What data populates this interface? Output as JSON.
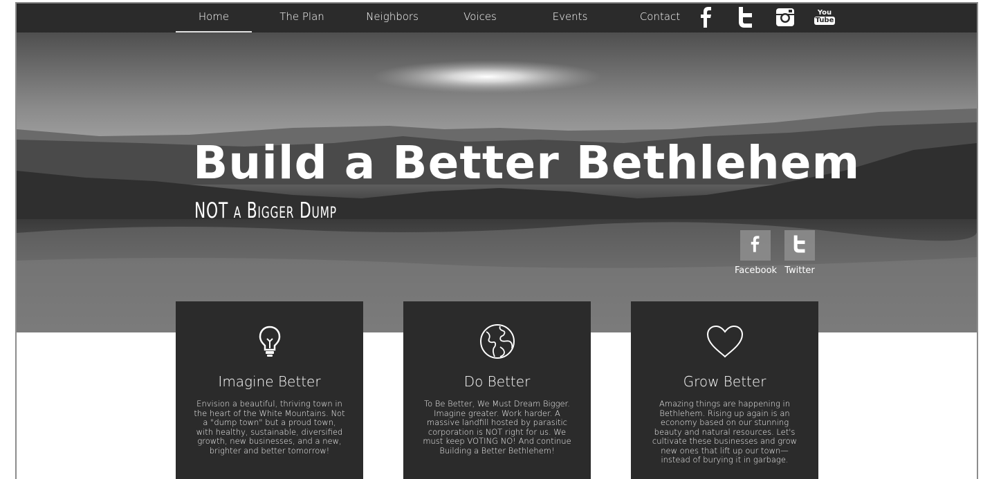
{
  "nav": {
    "items": [
      {
        "label": "Home",
        "active": true
      },
      {
        "label": "The Plan",
        "active": false
      },
      {
        "label": "Neighbors",
        "active": false
      },
      {
        "label": "Voices",
        "active": false
      },
      {
        "label": "Events",
        "active": false
      },
      {
        "label": "Contact",
        "active": false
      }
    ],
    "social": [
      {
        "icon": "facebook-icon"
      },
      {
        "icon": "twitter-icon"
      },
      {
        "icon": "instagram-icon"
      },
      {
        "icon": "youtube-icon",
        "text_top": "You",
        "text_bottom": "Tube"
      }
    ]
  },
  "hero": {
    "title": "Build a Better Bethlehem",
    "subtitle": "NOT a Bigger Dump",
    "share": [
      {
        "label": "Facebook",
        "icon": "facebook-icon"
      },
      {
        "label": "Twitter",
        "icon": "twitter-icon"
      }
    ]
  },
  "cards": [
    {
      "icon": "lightbulb-icon",
      "title": "Imagine Better",
      "text": "Envision a beautiful, thriving  town in the heart of the White Mountains. Not a \"dump town\" but a proud town, with healthy, sustainable, diversified growth, new businesses, and a new, brighter and better tomorrow!"
    },
    {
      "icon": "globe-icon",
      "title": "Do Better",
      "text": "To Be Better, We Must Dream Bigger. Imagine greater. Work harder. A massive landfill hosted by parasitic corporation is NOT right for us. We must keep VOTING NO!  And continue Building a Better Bethlehem!"
    },
    {
      "icon": "heart-icon",
      "title": "Grow Better",
      "text": "Amazing things are happening in Bethlehem. Rising up again is an economy based on our stunning beauty and natural resources. Let's cultivate these businesses and grow new ones that lift up our town—instead of burying it in garbage."
    }
  ],
  "colors": {
    "nav_bg": "#2b2b2b",
    "card_bg": "#2b2b2b",
    "text": "#ffffff"
  }
}
